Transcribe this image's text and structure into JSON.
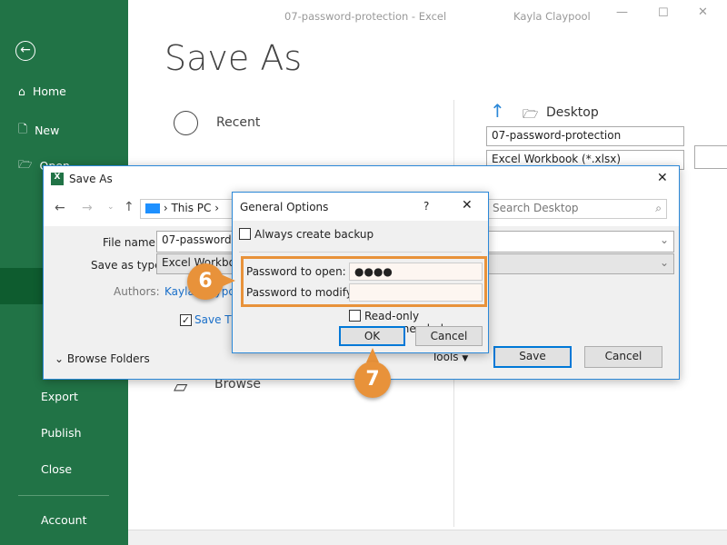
{
  "window": {
    "title": "07-password-protection  -  Excel",
    "user": "Kayla Claypool"
  },
  "sidebar": {
    "items": [
      {
        "label": "Home"
      },
      {
        "label": "New"
      },
      {
        "label": "Open"
      },
      {
        "label": "Export"
      },
      {
        "label": "Publish"
      },
      {
        "label": "Close"
      },
      {
        "label": "Account"
      }
    ]
  },
  "backstage": {
    "title": "Save As",
    "recent": "Recent",
    "browse": "Browse",
    "location": "Desktop",
    "filename": "07-password-protection",
    "filetype": "Excel Workbook (*.xlsx)"
  },
  "saveas_dialog": {
    "title": "Save As",
    "breadcrumb": "This PC",
    "search_placeholder": "Search Desktop",
    "filename_label": "File name:",
    "filename": "07-password-p",
    "type_label": "Save as type:",
    "type": "Excel Workbo",
    "authors_label": "Authors:",
    "authors": "Kayla Claypool",
    "thumbnail": "Save Thumbnail",
    "browse_folders": "Browse Folders",
    "tools": "Tools",
    "save": "Save",
    "cancel": "Cancel"
  },
  "general_options": {
    "title": "General Options",
    "help": "?",
    "backup": "Always create backup",
    "backup_checked": false,
    "open_label": "Password to open:",
    "open_value": "●●●●",
    "modify_label": "Password to modify:",
    "modify_value": "",
    "readonly": "Read-only recommended",
    "readonly_checked": false,
    "ok": "OK",
    "cancel": "Cancel"
  },
  "callouts": [
    "6",
    "7"
  ],
  "colors": {
    "excel_green": "#217346",
    "accent": "#0078d7",
    "callout": "#e8923a"
  }
}
